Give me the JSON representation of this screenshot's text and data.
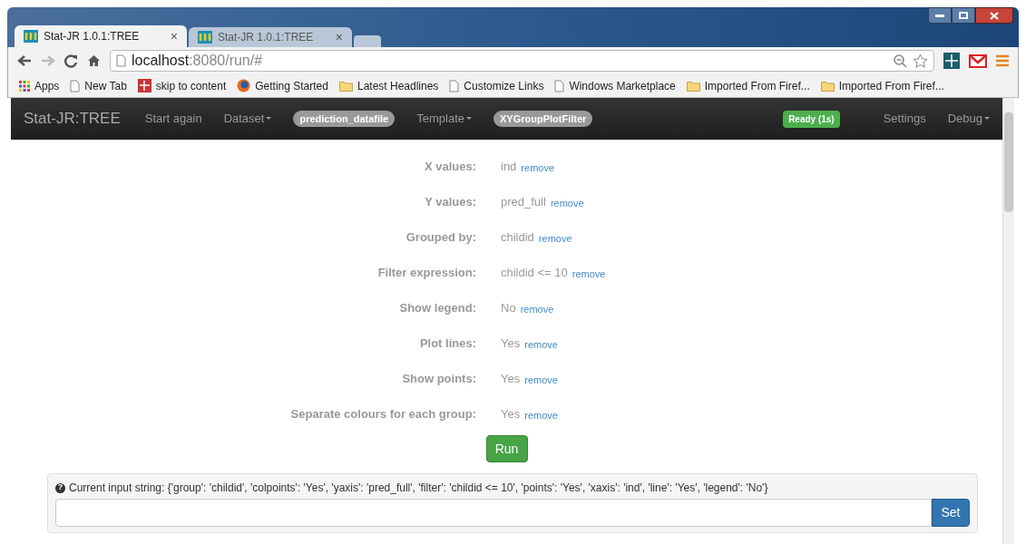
{
  "browser": {
    "tabs": [
      {
        "title": "Stat-JR 1.0.1:TREE",
        "close": "×",
        "selected": true
      },
      {
        "title": "Stat-JR 1.0.1:TREE",
        "close": "×",
        "selected": false
      }
    ],
    "address": {
      "host": "localhost",
      "path": ":8080/run/#"
    },
    "bookmarks": [
      {
        "kind": "apps",
        "label": "Apps"
      },
      {
        "kind": "page",
        "label": "New Tab"
      },
      {
        "kind": "site",
        "label": "skip to content"
      },
      {
        "kind": "firefox",
        "label": "Getting Started"
      },
      {
        "kind": "folder",
        "label": "Latest Headlines"
      },
      {
        "kind": "page",
        "label": "Customize Links"
      },
      {
        "kind": "page",
        "label": "Windows Marketplace"
      },
      {
        "kind": "folder",
        "label": "Imported From Firef..."
      },
      {
        "kind": "folder",
        "label": "Imported From Firef..."
      }
    ]
  },
  "navbar": {
    "brand": "Stat-JR:TREE",
    "items": [
      {
        "kind": "link",
        "label": "Start again"
      },
      {
        "kind": "dropdown",
        "label": "Dataset"
      },
      {
        "kind": "pill",
        "label": "prediction_datafile"
      },
      {
        "kind": "dropdown",
        "label": "Template"
      },
      {
        "kind": "pill",
        "label": "XYGroupPlotFilter"
      }
    ],
    "status": "Ready (1s)",
    "right_items": [
      {
        "kind": "link",
        "label": "Settings"
      },
      {
        "kind": "dropdown",
        "label": "Debug"
      }
    ]
  },
  "form": {
    "rows": [
      {
        "label": "X values:",
        "value": "ind",
        "action": "remove"
      },
      {
        "label": "Y values:",
        "value": "pred_full",
        "action": "remove"
      },
      {
        "label": "Grouped by:",
        "value": "childid",
        "action": "remove"
      },
      {
        "label": "Filter expression:",
        "value": "childid <= 10",
        "action": "remove"
      },
      {
        "label": "Show legend:",
        "value": "No",
        "action": "remove"
      },
      {
        "label": "Plot lines:",
        "value": "Yes",
        "action": "remove"
      },
      {
        "label": "Show points:",
        "value": "Yes",
        "action": "remove"
      },
      {
        "label": "Separate colours for each group:",
        "value": "Yes",
        "action": "remove"
      }
    ],
    "run_button": "Run"
  },
  "input_panel": {
    "help": "?",
    "text": "Current input string: {'group': 'childid', 'colpoints': 'Yes', 'yaxis': 'pred_full', 'filter': 'childid <= 10', 'points': 'Yes', 'xaxis': 'ind', 'line': 'Yes', 'legend': 'No'}",
    "button": "Set"
  }
}
